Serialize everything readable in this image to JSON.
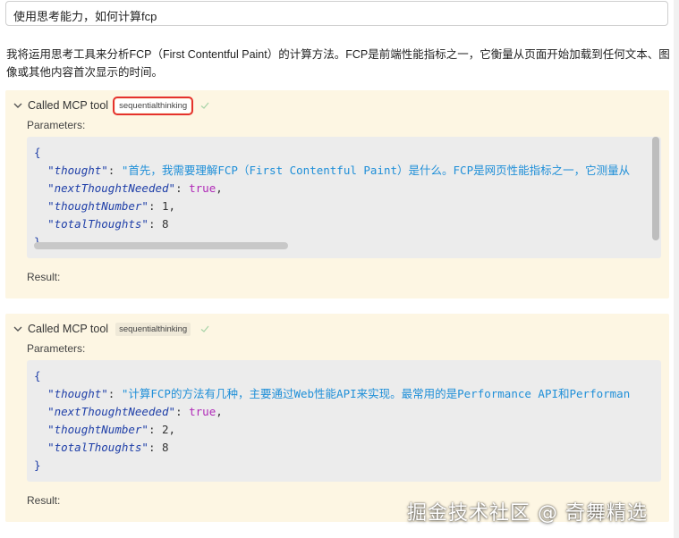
{
  "user_message": "使用思考能力，如何计算fcp",
  "intro": "我将运用思考工具来分析FCP（First Contentful Paint）的计算方法。FCP是前端性能指标之一，它衡量从页面开始加载到任何文本、图像或其他内容首次显示的时间。",
  "tool_calls": [
    {
      "header": "Called MCP tool",
      "tool_name": "sequentialthinking",
      "params_label": "Parameters:",
      "result_label": "Result:",
      "thought": "\"首先，我需要理解FCP（First Contentful Paint）是什么。FCP是网页性能指标之一，它测量从",
      "nextThoughtNeeded": "true",
      "thoughtNumber": "1",
      "totalThoughts": "8"
    },
    {
      "header": "Called MCP tool",
      "tool_name": "sequentialthinking",
      "params_label": "Parameters:",
      "result_label": "Result:",
      "thought": "\"计算FCP的方法有几种，主要通过Web性能API来实现。最常用的是Performance API和Performan",
      "nextThoughtNeeded": "true",
      "thoughtNumber": "2",
      "totalThoughts": "8"
    }
  ],
  "keys": {
    "thought": "\"thought\"",
    "nextThoughtNeeded": "\"nextThoughtNeeded\"",
    "thoughtNumber": "\"thoughtNumber\"",
    "totalThoughts": "\"totalThoughts\""
  },
  "watermark": "掘金技术社区 @ 奇舞精选",
  "colors": {
    "tool_bg": "#fdf6e3",
    "code_bg": "#ececec",
    "highlight": "#e5322d",
    "check": "#9ccf9c"
  }
}
